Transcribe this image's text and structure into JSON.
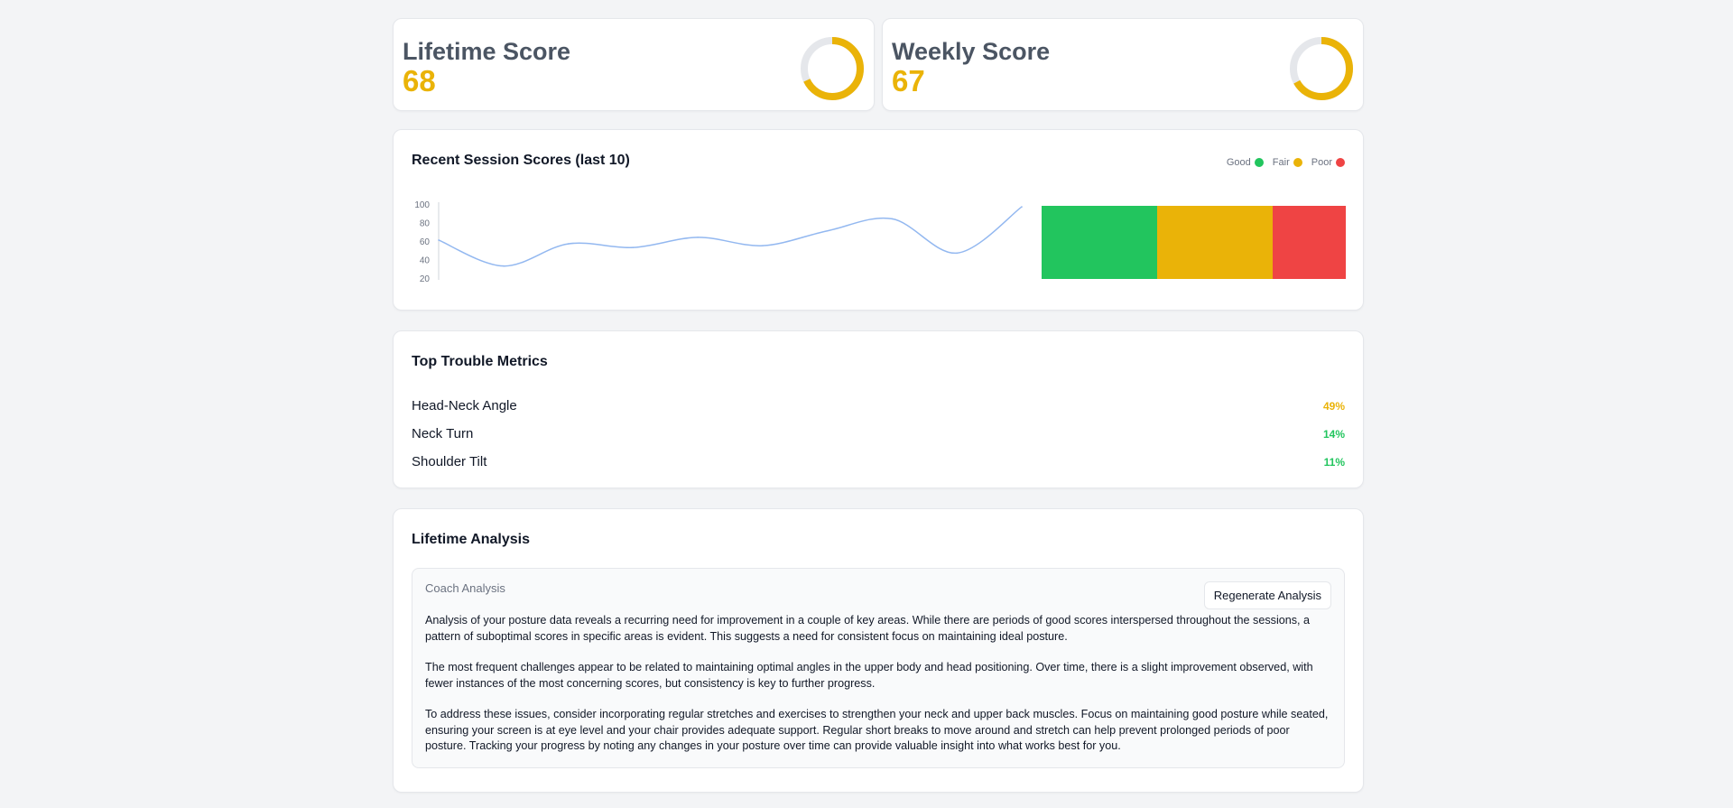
{
  "scores": {
    "lifetime": {
      "title": "Lifetime Score",
      "value": "68",
      "ratio": 0.68
    },
    "weekly": {
      "title": "Weekly Score",
      "value": "67",
      "ratio": 0.67
    }
  },
  "colors": {
    "accent": "#eab308",
    "good": "#22c55e",
    "fair": "#eab308",
    "poor": "#ef4444",
    "line": "#93b8f0",
    "ring_track": "#e5e7eb"
  },
  "recent_sessions": {
    "title": "Recent Session Scores (last 10)",
    "legend": [
      "Good",
      "Fair",
      "Poor"
    ]
  },
  "chart_data": [
    {
      "type": "line",
      "title": "",
      "xlabel": "",
      "ylabel": "",
      "x": [
        1,
        2,
        3,
        4,
        5,
        6,
        7,
        8,
        9,
        10
      ],
      "y": [
        61,
        33,
        57,
        53,
        64,
        55,
        71,
        84,
        47,
        97
      ],
      "ylim": [
        20,
        100
      ],
      "yticks": [
        100,
        80,
        60,
        40,
        20
      ],
      "grid": false
    },
    {
      "type": "bar",
      "orientation": "horizontal-stacked",
      "categories": [
        "Good",
        "Fair",
        "Poor"
      ],
      "values": [
        38,
        38,
        24
      ],
      "colors": [
        "#22c55e",
        "#eab308",
        "#ef4444"
      ]
    }
  ],
  "trouble_metrics": {
    "title": "Top Trouble Metrics",
    "items": [
      {
        "label": "Head-Neck Angle",
        "value": "49%",
        "color": "#eab308"
      },
      {
        "label": "Neck Turn",
        "value": "14%",
        "color": "#22c55e"
      },
      {
        "label": "Shoulder Tilt",
        "value": "11%",
        "color": "#22c55e"
      }
    ]
  },
  "analysis": {
    "title": "Lifetime Analysis",
    "coach_label": "Coach Analysis",
    "regenerate_label": "Regenerate Analysis",
    "paragraphs": [
      "Analysis of your posture data reveals a recurring need for improvement in a couple of key areas.  While there are periods of good scores interspersed throughout the sessions, a pattern of suboptimal scores in specific areas is evident.  This suggests a need for consistent focus on maintaining ideal posture.",
      "The most frequent challenges appear to be related to maintaining optimal angles in the upper body and head positioning.  Over time, there is a slight improvement observed, with fewer instances of the most concerning scores, but consistency is key to further progress.",
      "To address these issues, consider incorporating regular stretches and exercises to strengthen your neck and upper back muscles.  Focus on maintaining good posture while seated, ensuring your screen is at eye level and your chair provides adequate support.  Regular short breaks to move around and stretch can help prevent prolonged periods of poor posture.  Tracking your progress by noting any changes in your posture over time can provide valuable insight into what works best for you."
    ]
  }
}
